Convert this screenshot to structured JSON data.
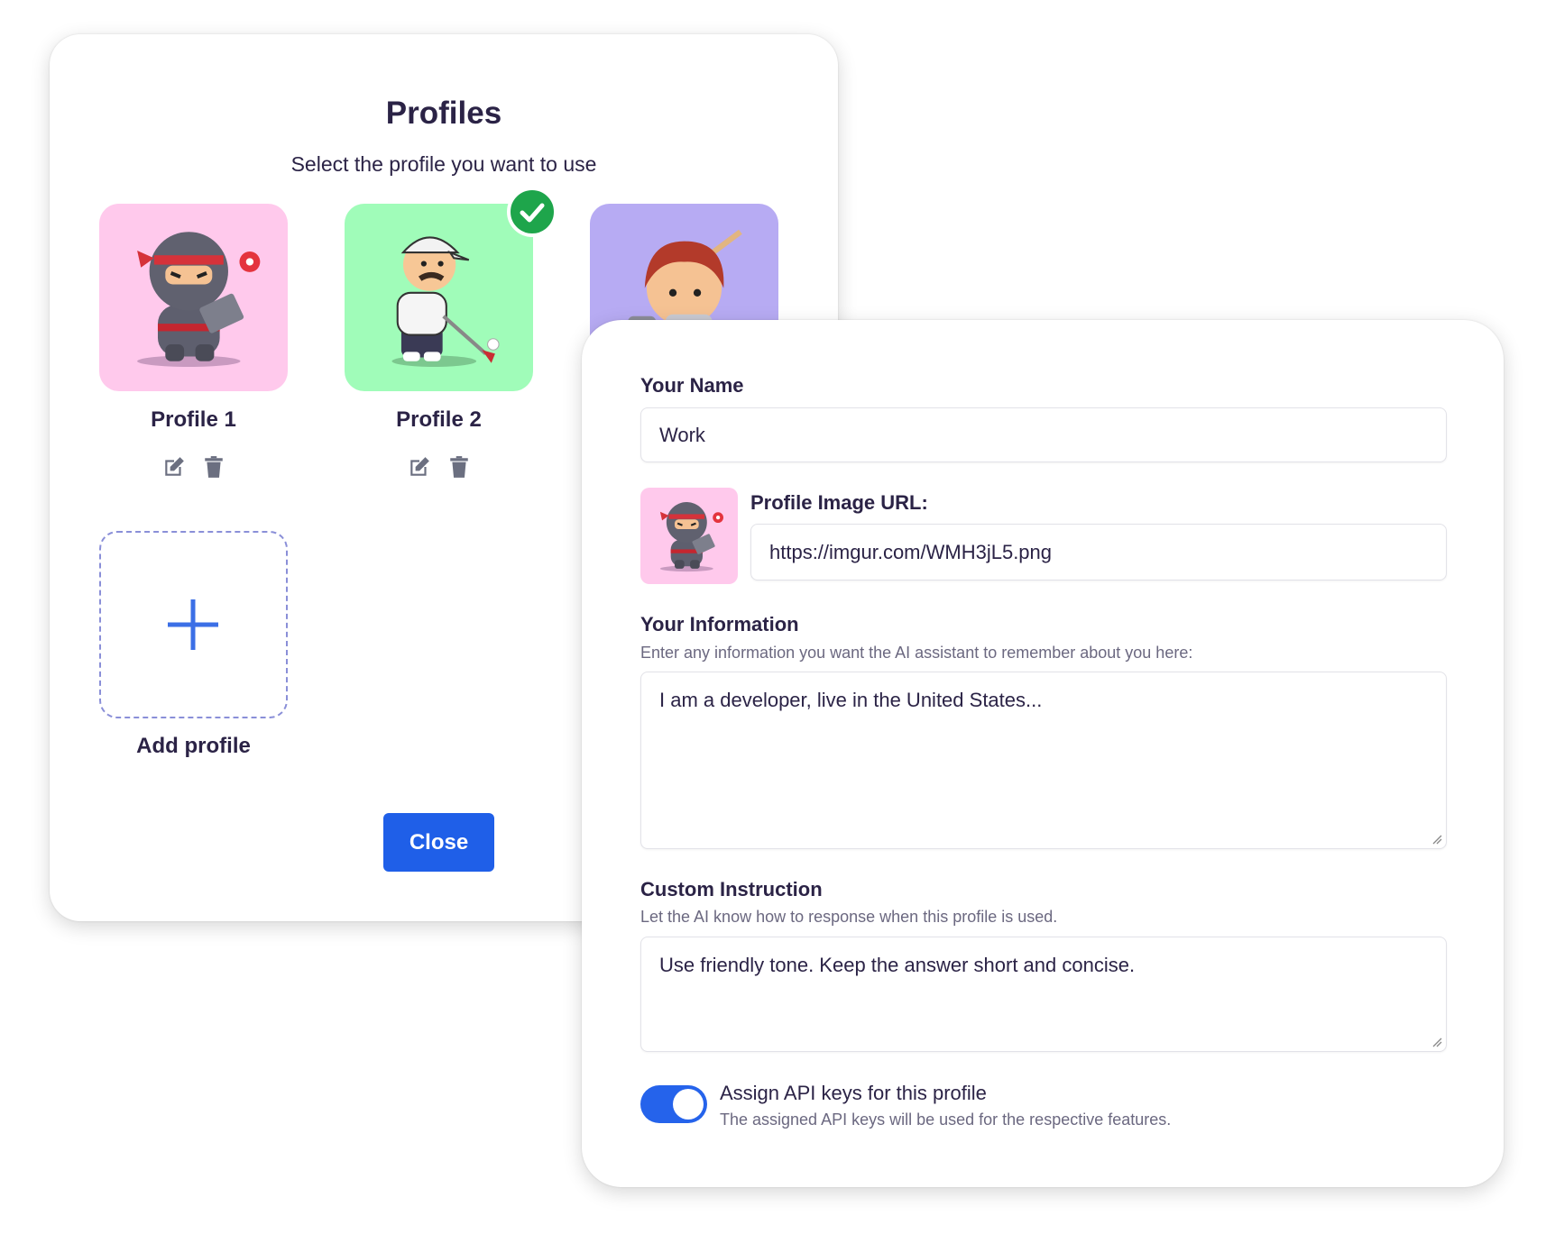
{
  "profiles_dialog": {
    "title": "Profiles",
    "subtitle": "Select the profile you want to use",
    "profiles": [
      {
        "label": "Profile 1",
        "avatar": "ninja-with-laptop",
        "bg_color": "#ffc9ec",
        "selected": false
      },
      {
        "label": "Profile 2",
        "avatar": "golfer",
        "bg_color": "#a0fcb9",
        "selected": true
      },
      {
        "label": "",
        "avatar": "boy-with-sword",
        "bg_color": "#b7abf3",
        "selected": false
      }
    ],
    "add_profile_label": "Add profile",
    "close_label": "Close",
    "selected_badge_color": "#1ea54b",
    "accent_color": "#1f5fe8"
  },
  "edit_form": {
    "name_label": "Your Name",
    "name_value": "Work",
    "image_url_label": "Profile Image URL:",
    "image_url_value": "https://imgur.com/WMH3jL5.png",
    "info_label": "Your Information",
    "info_help": "Enter any information you want the AI assistant to remember about you here:",
    "info_value": "I am a developer, live in the United States...",
    "instruction_label": "Custom Instruction",
    "instruction_help": "Let the AI know how to response when this profile is used.",
    "instruction_value": "Use friendly tone. Keep the answer short and concise.",
    "api_toggle_label": "Assign API keys for this profile",
    "api_toggle_help": "The assigned API keys will be used for the respective features.",
    "api_toggle_on": true
  }
}
